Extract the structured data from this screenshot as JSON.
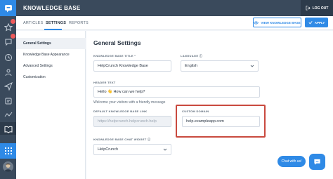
{
  "topbar": {
    "title": "KNOWLEDGE BASE",
    "logout_label": "LOG OUT"
  },
  "rail": {
    "items": [
      {
        "icon": "star-icon",
        "badge": ""
      },
      {
        "icon": "chat-icon",
        "badge": ""
      },
      {
        "icon": "clock-icon",
        "badge": ""
      },
      {
        "icon": "people-icon",
        "badge": ""
      },
      {
        "icon": "send-icon",
        "badge": ""
      },
      {
        "icon": "ticket-icon",
        "badge": ""
      },
      {
        "icon": "analytics-icon",
        "badge": ""
      },
      {
        "icon": "book-icon",
        "badge": ""
      }
    ]
  },
  "tabs": [
    {
      "label": "ARTICLES"
    },
    {
      "label": "SETTINGS"
    },
    {
      "label": "REPORTS"
    }
  ],
  "actions": {
    "view_label": "VIEW KNOWLEDGE BASE",
    "apply_label": "APPLY"
  },
  "submenu": {
    "items": [
      {
        "label": "General Settings"
      },
      {
        "label": "Knowledge Base Appearance"
      },
      {
        "label": "Advanced Settings"
      },
      {
        "label": "Customization"
      }
    ]
  },
  "form": {
    "heading": "General Settings",
    "kb_title": {
      "label": "KNOWLEDGE BASE TITLE *",
      "value": "HelpCrunch Knowledge Base"
    },
    "language": {
      "label": "LANGUAGE",
      "value": "English"
    },
    "header_text": {
      "label": "HEADER TEXT",
      "value": "Hello 👋 How can we help?",
      "hint": "Welcome your visitors with a friendly message"
    },
    "default_link": {
      "label": "DEFAULT KNOWLEDGE BASE LINK",
      "value": "https://helpcrunch.helpcrunch.help"
    },
    "custom_domain": {
      "label": "CUSTOM DOMAIN",
      "value": "help.exampleapp.com"
    },
    "chat_widget": {
      "label": "KNOWLEDGE BASE CHAT WIDGET",
      "value": "HelpCrunch"
    }
  },
  "chat": {
    "bubble_text": "Chat with us!"
  },
  "colors": {
    "accent": "#2f8ae6",
    "rail": "#3a4a5c",
    "highlight": "#c94a3f"
  }
}
